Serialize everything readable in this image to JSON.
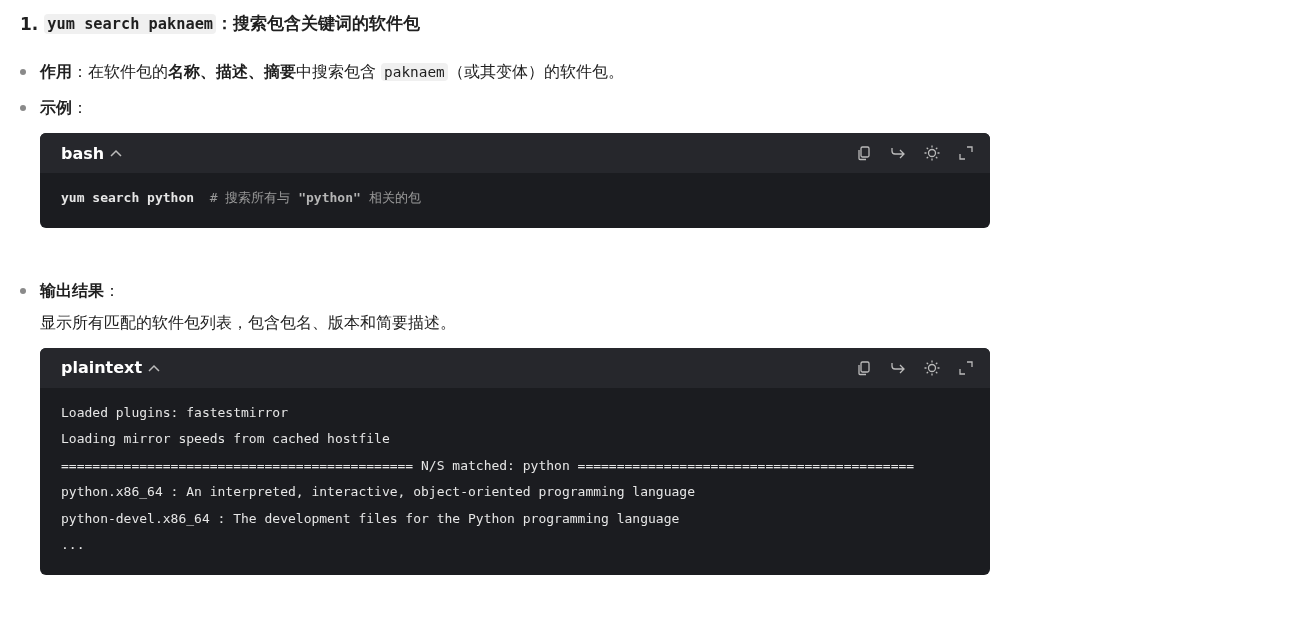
{
  "heading": {
    "number": "1.",
    "segments": [
      {
        "kind": "code",
        "text": "yum search paknaem"
      },
      {
        "kind": "text",
        "text": "：搜索包含关键词的软件包"
      }
    ]
  },
  "items": [
    {
      "segments": [
        {
          "kind": "text",
          "text": "**作用**：在软件包的**名称、描述、摘要**中搜索包含 "
        },
        {
          "kind": "code",
          "text": "paknaem"
        },
        {
          "kind": "text",
          "text": "（或其变体）的软件包。"
        }
      ]
    },
    {
      "segments": [
        {
          "kind": "text",
          "text": "**示例**："
        }
      ],
      "code_block": {
        "language": "bash",
        "expanded": true,
        "lines": [
          [
            {
              "kind": "command",
              "text": "yum search python  "
            },
            {
              "kind": "comment",
              "text": "# 搜索所有与 "
            },
            {
              "kind": "string",
              "text": "\"python\""
            },
            {
              "kind": "comment",
              "text": " 相关的包"
            }
          ]
        ]
      }
    },
    {
      "segments": [
        {
          "kind": "text",
          "text": "**输出结果**："
        }
      ],
      "paragraph": "显示所有匹配的软件包列表，包含包名、版本和简要描述。",
      "code_block": {
        "language": "plaintext",
        "expanded": true,
        "lines": [
          [
            {
              "kind": "plain",
              "text": "Loaded plugins: fastestmirror"
            }
          ],
          [
            {
              "kind": "plain",
              "text": "Loading mirror speeds from cached hostfile"
            }
          ],
          [
            {
              "kind": "plain",
              "text": "============================================= N/S matched: python ==========================================="
            }
          ],
          [
            {
              "kind": "plain",
              "text": "python.x86_64 : An interpreted, interactive, object-oriented programming language"
            }
          ],
          [
            {
              "kind": "plain",
              "text": "python-devel.x86_64 : The development files for the Python programming language"
            }
          ],
          [
            {
              "kind": "plain",
              "text": "..."
            }
          ]
        ]
      }
    }
  ]
}
